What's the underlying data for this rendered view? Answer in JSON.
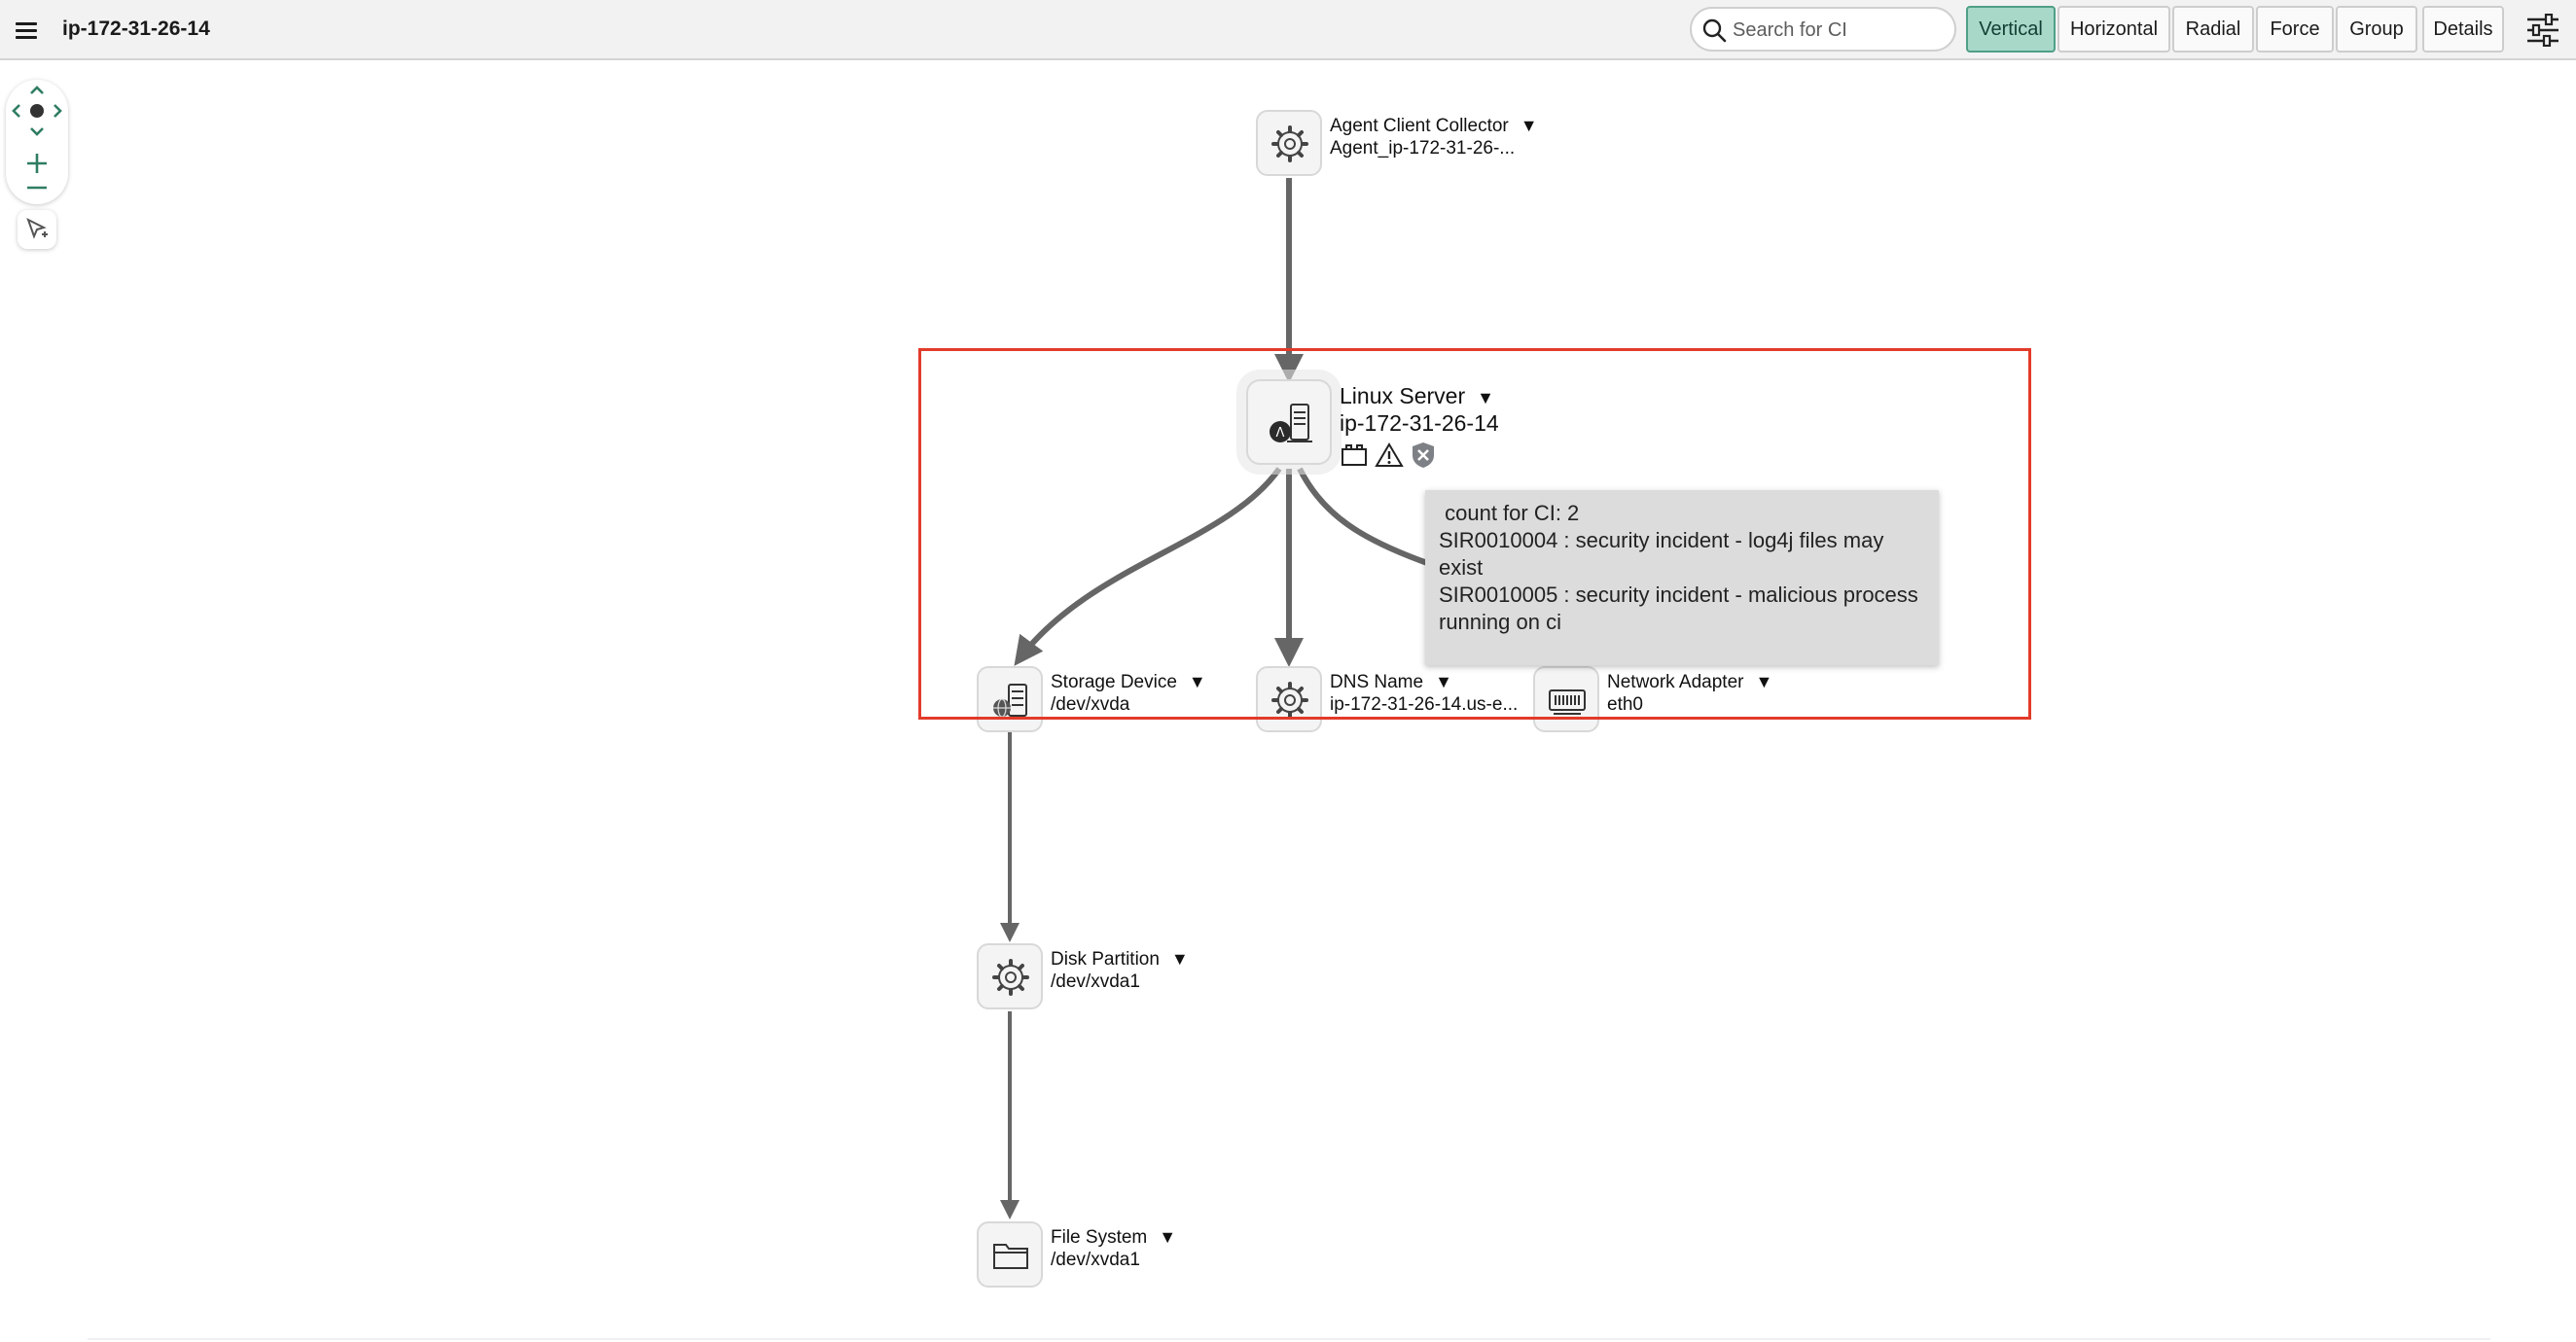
{
  "header": {
    "title": "ip-172-31-26-14",
    "search_placeholder": "Search for CI",
    "layout_buttons": [
      "Vertical",
      "Horizontal",
      "Radial",
      "Force",
      "Group"
    ],
    "active_layout": "Vertical",
    "details_label": "Details"
  },
  "nodes": {
    "agent": {
      "type": "Agent Client Collector",
      "name": "Agent_ip-172-31-26-..."
    },
    "linux": {
      "type": "Linux Server",
      "name": "ip-172-31-26-14"
    },
    "storage": {
      "type": "Storage Device",
      "name": "/dev/xvda"
    },
    "dns": {
      "type": "DNS Name",
      "name": "ip-172-31-26-14.us-e..."
    },
    "network": {
      "type": "Network Adapter",
      "name": "eth0"
    },
    "partition": {
      "type": "Disk Partition",
      "name": "/dev/xvda1"
    },
    "filesystem": {
      "type": "File System",
      "name": "/dev/xvda1"
    }
  },
  "tooltip": {
    "lines": [
      " count for CI: 2",
      "SIR0010004 : security incident - log4j files may exist",
      "SIR0010005 : security incident - malicious process running on ci"
    ]
  },
  "colors": {
    "active_button": "#a8d8c8",
    "highlight": "#e23b2a",
    "edge": "#666666",
    "controls": "#2f7d62"
  },
  "icons": {
    "agent": "gear-icon",
    "linux": "linux-server-icon",
    "storage": "storage-device-icon",
    "dns": "gear-icon",
    "network": "network-adapter-icon",
    "partition": "gear-icon",
    "filesystem": "folder-icon",
    "status": [
      "ci-status-icon",
      "warning-icon",
      "security-shield-icon"
    ]
  }
}
